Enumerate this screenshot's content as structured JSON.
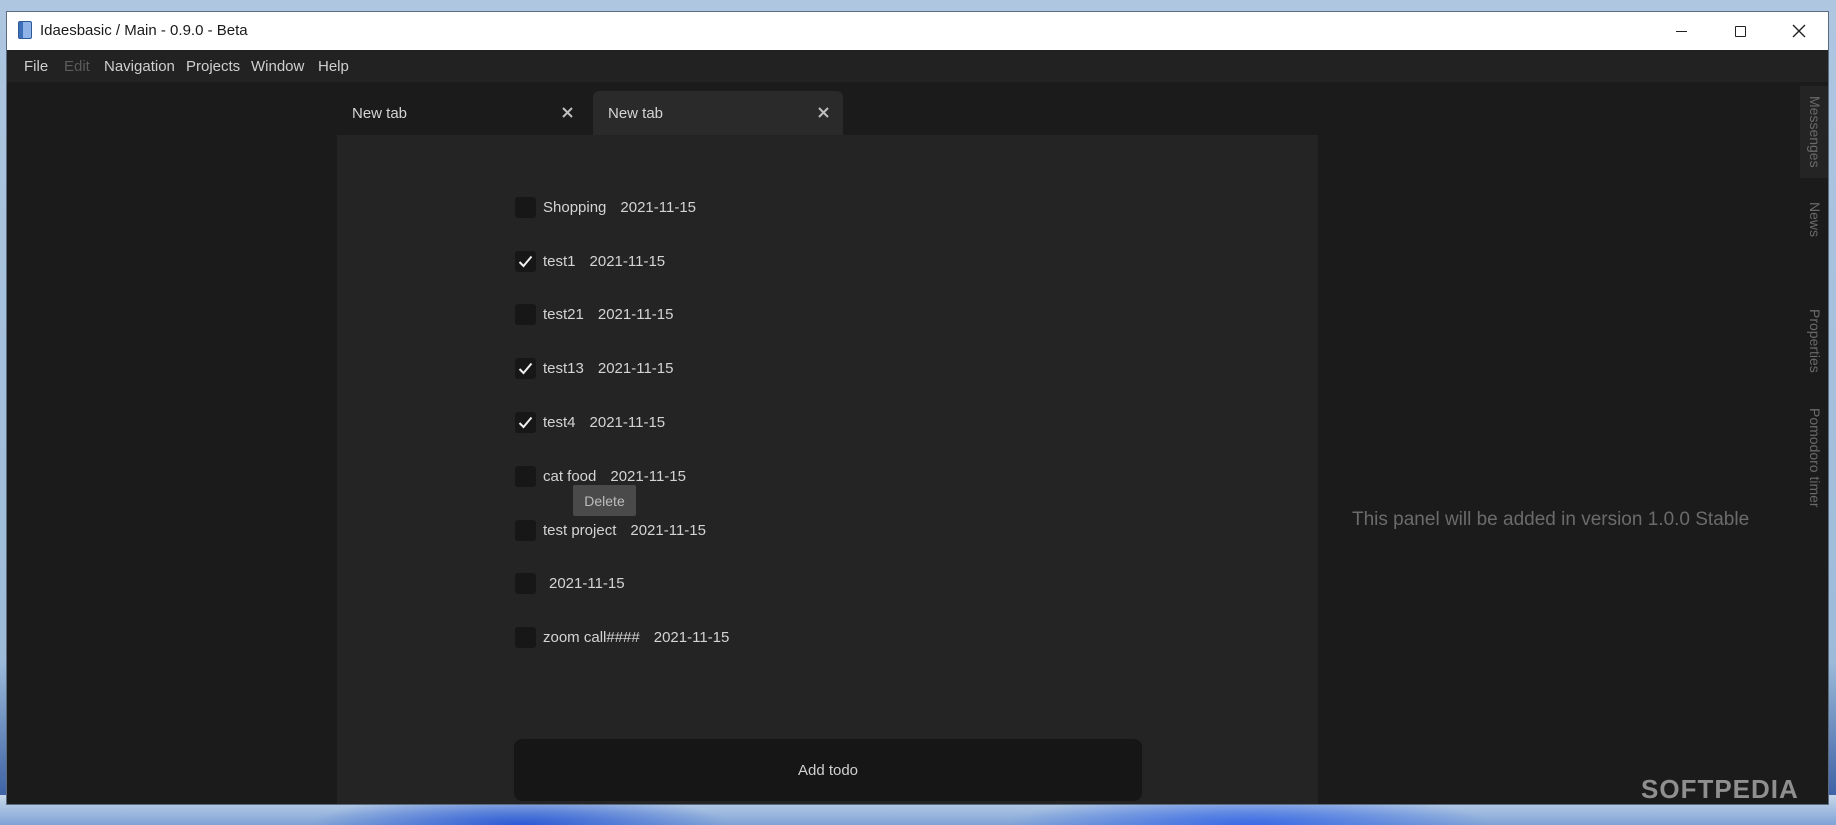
{
  "window": {
    "title": "Idaesbasic / Main - 0.9.0 - Beta"
  },
  "menu": {
    "items": [
      {
        "label": "File",
        "enabled": true
      },
      {
        "label": "Edit",
        "enabled": false
      },
      {
        "label": "Navigation",
        "enabled": true
      },
      {
        "label": "Projects",
        "enabled": true
      },
      {
        "label": "Window",
        "enabled": true
      },
      {
        "label": "Help",
        "enabled": true
      }
    ]
  },
  "tabs": [
    {
      "label": "New tab",
      "active": false
    },
    {
      "label": "New tab",
      "active": true
    }
  ],
  "todos": [
    {
      "text": "Shopping",
      "date": "2021-11-15",
      "checked": false
    },
    {
      "text": "test1",
      "date": "2021-11-15",
      "checked": true
    },
    {
      "text": "test21",
      "date": "2021-11-15",
      "checked": false
    },
    {
      "text": "test13",
      "date": "2021-11-15",
      "checked": true
    },
    {
      "text": "test4",
      "date": "2021-11-15",
      "checked": true
    },
    {
      "text": "cat food",
      "date": "2021-11-15",
      "checked": false
    },
    {
      "text": "test project",
      "date": "2021-11-15",
      "checked": false
    },
    {
      "text": "",
      "date": "2021-11-15",
      "checked": false
    },
    {
      "text": "zoom call####",
      "date": "2021-11-15",
      "checked": false
    }
  ],
  "tooltip": {
    "label": "Delete"
  },
  "add_button": {
    "label": "Add todo"
  },
  "right_panel": {
    "message": "This panel will be added in version 1.0.0 Stable"
  },
  "side_tabs": [
    {
      "label": "Messenges",
      "active": true
    },
    {
      "label": "News",
      "active": false
    },
    {
      "label": "Properties",
      "active": false
    },
    {
      "label": "Pomodoro timer",
      "active": false
    }
  ],
  "watermark": {
    "text": "SOFTPEDIA"
  },
  "colors": {
    "background": "#1b1b1b",
    "panel": "#242424",
    "checkbox": "#171717",
    "text": "#d4d4d4"
  },
  "icons": {
    "app": "notebook-icon",
    "check": "checkmark-icon",
    "close": "close-icon"
  }
}
